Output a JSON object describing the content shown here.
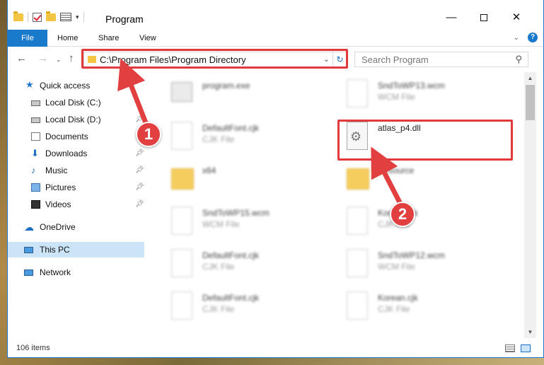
{
  "window": {
    "title": "Program",
    "controls": {
      "minimize": "—",
      "maximize": "",
      "close": "✕"
    }
  },
  "ribbon": {
    "tabs": [
      "File",
      "Home",
      "Share",
      "View"
    ],
    "help": "?",
    "collapse": "⌄"
  },
  "nav": {
    "back": "←",
    "forward": "→",
    "recent": "⌄",
    "up": "↑",
    "address": "C:\\Program Files\\Program Directory",
    "address_dropdown": "⌄",
    "refresh": "↻",
    "search_placeholder": "Search Program",
    "search_icon": "⚲"
  },
  "sidebar": {
    "items": [
      {
        "label": "Quick access",
        "icon": "star-icon",
        "pinned": false
      },
      {
        "label": "Local Disk (C:)",
        "icon": "disk-icon",
        "pinned": false
      },
      {
        "label": "Local Disk (D:)",
        "icon": "disk-icon",
        "pinned": true
      },
      {
        "label": "Documents",
        "icon": "documents-icon",
        "pinned": true
      },
      {
        "label": "Downloads",
        "icon": "downloads-icon",
        "pinned": true
      },
      {
        "label": "Music",
        "icon": "music-icon",
        "pinned": true
      },
      {
        "label": "Pictures",
        "icon": "pictures-icon",
        "pinned": true
      },
      {
        "label": "Videos",
        "icon": "videos-icon",
        "pinned": true
      },
      {
        "label": "OneDrive",
        "icon": "onedrive-icon",
        "pinned": false
      },
      {
        "label": "This PC",
        "icon": "this-pc-icon",
        "pinned": false,
        "selected": true
      },
      {
        "label": "Network",
        "icon": "network-icon",
        "pinned": false
      }
    ]
  },
  "files": [
    {
      "name": "program.exe",
      "type": "",
      "kind": "exe"
    },
    {
      "name": "SndToWP13.wcm",
      "type": "WCM File",
      "kind": "file"
    },
    {
      "name": "DefaultFont.cjk",
      "type": "CJK File",
      "kind": "file"
    },
    {
      "name": "atlas_p4.dll",
      "type": "",
      "kind": "dll"
    },
    {
      "name": "x64",
      "type": "",
      "kind": "folder"
    },
    {
      "name": "Resource",
      "type": "",
      "kind": "folder"
    },
    {
      "name": "SndToWP15.wcm",
      "type": "WCM File",
      "kind": "file"
    },
    {
      "name": "Korean.cjk",
      "type": "CJK File",
      "kind": "file"
    },
    {
      "name": "DefaultFont.cjk",
      "type": "CJK File",
      "kind": "file"
    },
    {
      "name": "SndToWP12.wcm",
      "type": "WCM File",
      "kind": "file"
    },
    {
      "name": "DefaultFont.cjk",
      "type": "CJK File",
      "kind": "file"
    },
    {
      "name": "Korean.cjk",
      "type": "CJK File",
      "kind": "file"
    }
  ],
  "status": {
    "item_count": "106 items"
  },
  "callouts": {
    "step1": "1",
    "step2": "2"
  },
  "colors": {
    "accent": "#1979ca",
    "highlight": "#e0393e",
    "selected": "#cce4f7"
  }
}
